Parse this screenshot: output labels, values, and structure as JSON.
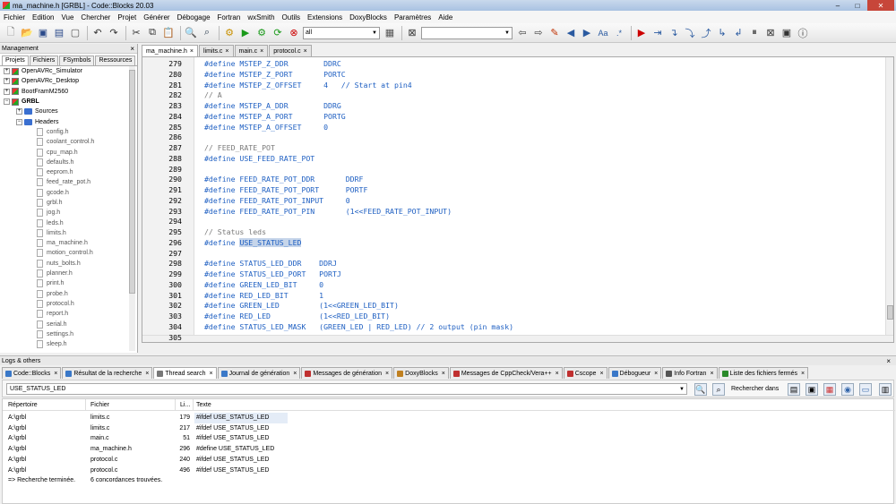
{
  "window": {
    "title": "ma_machine.h [GRBL] - Code::Blocks 20.03",
    "minimize": "–",
    "maximize": "□",
    "close": "✕"
  },
  "menu": [
    "Fichier",
    "Edition",
    "Vue",
    "Chercher",
    "Projet",
    "Générer",
    "Débogage",
    "Fortran",
    "wxSmith",
    "Outils",
    "Extensions",
    "DoxyBlocks",
    "Paramètres",
    "Aide"
  ],
  "toolbar": {
    "target_combo": "all",
    "search_combo": "",
    "icons": [
      "new-file-icon",
      "open-icon",
      "save-icon",
      "save-all-icon",
      "undo-icon",
      "redo-icon",
      "cut-icon",
      "copy-icon",
      "paste-icon",
      "find-icon",
      "replace-icon"
    ]
  },
  "management": {
    "title": "Management",
    "close": "×",
    "tabs": [
      "Projets",
      "Fichiers",
      "FSymbols",
      "Ressources"
    ],
    "tree": [
      {
        "label": "OpenAVRc_Simulator",
        "type": "project",
        "level": 0,
        "exp": "+"
      },
      {
        "label": "OpenAVRc_Desktop",
        "type": "project",
        "level": 0,
        "exp": "+"
      },
      {
        "label": "BootFramM2560",
        "type": "project",
        "level": 0,
        "exp": "+"
      },
      {
        "label": "GRBL",
        "type": "project",
        "level": 0,
        "exp": "−",
        "bold": true
      },
      {
        "label": "Sources",
        "type": "folder",
        "level": 1,
        "exp": "+"
      },
      {
        "label": "Headers",
        "type": "folder",
        "level": 1,
        "exp": "−"
      },
      {
        "label": "config.h",
        "type": "file",
        "level": 2
      },
      {
        "label": "coolant_control.h",
        "type": "file",
        "level": 2
      },
      {
        "label": "cpu_map.h",
        "type": "file",
        "level": 2
      },
      {
        "label": "defaults.h",
        "type": "file",
        "level": 2
      },
      {
        "label": "eeprom.h",
        "type": "file",
        "level": 2
      },
      {
        "label": "feed_rate_pot.h",
        "type": "file",
        "level": 2
      },
      {
        "label": "gcode.h",
        "type": "file",
        "level": 2
      },
      {
        "label": "grbl.h",
        "type": "file",
        "level": 2
      },
      {
        "label": "jog.h",
        "type": "file",
        "level": 2
      },
      {
        "label": "leds.h",
        "type": "file",
        "level": 2
      },
      {
        "label": "limits.h",
        "type": "file",
        "level": 2
      },
      {
        "label": "ma_machine.h",
        "type": "file",
        "level": 2
      },
      {
        "label": "motion_control.h",
        "type": "file",
        "level": 2
      },
      {
        "label": "nuts_bolts.h",
        "type": "file",
        "level": 2
      },
      {
        "label": "planner.h",
        "type": "file",
        "level": 2
      },
      {
        "label": "print.h",
        "type": "file",
        "level": 2
      },
      {
        "label": "probe.h",
        "type": "file",
        "level": 2
      },
      {
        "label": "protocol.h",
        "type": "file",
        "level": 2
      },
      {
        "label": "report.h",
        "type": "file",
        "level": 2
      },
      {
        "label": "serial.h",
        "type": "file",
        "level": 2
      },
      {
        "label": "settings.h",
        "type": "file",
        "level": 2
      },
      {
        "label": "sleep.h",
        "type": "file",
        "level": 2
      }
    ]
  },
  "editor": {
    "tabs": [
      {
        "label": "ma_machine.h",
        "active": true
      },
      {
        "label": "limits.c",
        "active": false
      },
      {
        "label": "main.c",
        "active": false
      },
      {
        "label": "protocol.c",
        "active": false
      }
    ],
    "tab_close": "×",
    "lines": [
      {
        "n": "279",
        "t": "#define MSTEP_Z_DDR        DDRC"
      },
      {
        "n": "280",
        "t": "#define MSTEP_Z_PORT       PORTC"
      },
      {
        "n": "281",
        "t": "#define MSTEP_Z_OFFSET     4   // Start at pin4"
      },
      {
        "n": "282",
        "t": "// A",
        "cm": true
      },
      {
        "n": "283",
        "t": "#define MSTEP_A_DDR        DDRG"
      },
      {
        "n": "284",
        "t": "#define MSTEP_A_PORT       PORTG"
      },
      {
        "n": "285",
        "t": "#define MSTEP_A_OFFSET     0"
      },
      {
        "n": "286",
        "t": ""
      },
      {
        "n": "287",
        "t": "// FEED_RATE_POT",
        "cm": true
      },
      {
        "n": "288",
        "t": "#define USE_FEED_RATE_POT"
      },
      {
        "n": "289",
        "t": ""
      },
      {
        "n": "290",
        "t": "#define FEED_RATE_POT_DDR       DDRF"
      },
      {
        "n": "291",
        "t": "#define FEED_RATE_POT_PORT      PORTF"
      },
      {
        "n": "292",
        "t": "#define FEED_RATE_POT_INPUT     0"
      },
      {
        "n": "293",
        "t": "#define FEED_RATE_POT_PIN       (1<<FEED_RATE_POT_INPUT)"
      },
      {
        "n": "294",
        "t": ""
      },
      {
        "n": "295",
        "t": "// Status leds",
        "cm": true
      },
      {
        "n": "296",
        "t": "#define ",
        "hl": "USE_STATUS_LED"
      },
      {
        "n": "297",
        "t": ""
      },
      {
        "n": "298",
        "t": "#define STATUS_LED_DDR    DDRJ"
      },
      {
        "n": "299",
        "t": "#define STATUS_LED_PORT   PORTJ"
      },
      {
        "n": "300",
        "t": "#define GREEN_LED_BIT     0"
      },
      {
        "n": "301",
        "t": "#define RED_LED_BIT       1"
      },
      {
        "n": "302",
        "t": "#define GREEN_LED         (1<<GREEN_LED_BIT)"
      },
      {
        "n": "303",
        "t": "#define RED_LED           (1<<RED_LED_BIT)"
      },
      {
        "n": "304",
        "t": "#define STATUS_LED_MASK   (GREEN_LED | RED_LED) // 2 output (pin mask)"
      },
      {
        "n": "305",
        "t": ""
      }
    ]
  },
  "logs": {
    "title": "Logs & others",
    "close": "×",
    "tabs": [
      {
        "label": "Code::Blocks",
        "active": false
      },
      {
        "label": "Résultat de la recherche",
        "active": false
      },
      {
        "label": "Thread search",
        "active": true
      },
      {
        "label": "Journal de génération",
        "active": false
      },
      {
        "label": "Messages de génération",
        "active": false
      },
      {
        "label": "DoxyBlocks",
        "active": false
      },
      {
        "label": "Messages de CppCheck/Vera++",
        "active": false
      },
      {
        "label": "Cscope",
        "active": false
      },
      {
        "label": "Débogueur",
        "active": false
      },
      {
        "label": "Info Fortran",
        "active": false
      },
      {
        "label": "Liste des fichiers fermés",
        "active": false
      }
    ],
    "tab_close": "×",
    "search_value": "USE_STATUS_LED",
    "search_in_label": "Rechercher dans",
    "columns": [
      "Répertoire",
      "Fichier",
      "Li...",
      "Texte"
    ],
    "rows": [
      {
        "dir": "A:\\grbl",
        "file": "limits.c",
        "line": "179",
        "text": "#ifdef USE_STATUS_LED"
      },
      {
        "dir": "A:\\grbl",
        "file": "limits.c",
        "line": "217",
        "text": "#ifdef USE_STATUS_LED"
      },
      {
        "dir": "A:\\grbl",
        "file": "main.c",
        "line": "51",
        "text": "#ifdef USE_STATUS_LED"
      },
      {
        "dir": "A:\\grbl",
        "file": "ma_machine.h",
        "line": "296",
        "text": "#define USE_STATUS_LED"
      },
      {
        "dir": "A:\\grbl",
        "file": "protocol.c",
        "line": "240",
        "text": "#ifdef USE_STATUS_LED"
      },
      {
        "dir": "A:\\grbl",
        "file": "protocol.c",
        "line": "496",
        "text": "#ifdef USE_STATUS_LED"
      }
    ],
    "summary_dir": "=> Recherche terminée.",
    "summary_file": "6 concordances trouvées."
  }
}
